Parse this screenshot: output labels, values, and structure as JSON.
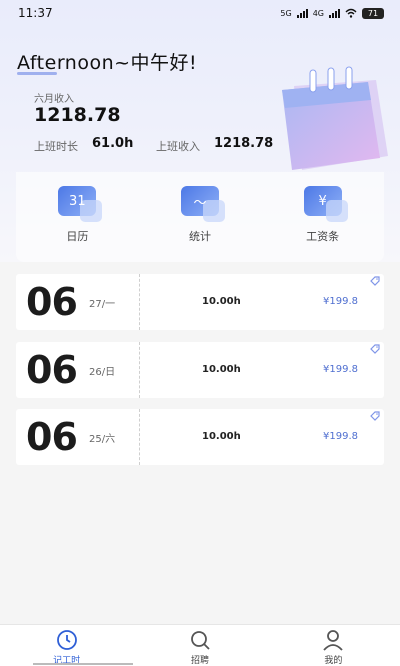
{
  "status_bar": {
    "time": "11:37",
    "network": "5G",
    "network2": "4G",
    "battery": "71"
  },
  "greeting": "Afternoon~中午好!",
  "income": {
    "month_label": "六月收入",
    "month_value": "1218.78",
    "hours_label": "上班时长",
    "hours_value": "61.0h",
    "earnings_label": "上班收入",
    "earnings_value": "1218.78"
  },
  "shortcuts": [
    {
      "label": "日历",
      "icon": "calendar-icon",
      "glyph": "31"
    },
    {
      "label": "统计",
      "icon": "stats-icon",
      "glyph": "〜"
    },
    {
      "label": "工资条",
      "icon": "payslip-icon",
      "glyph": "¥"
    }
  ],
  "records": [
    {
      "month": "06",
      "day": "27/一",
      "hours": "10.00h",
      "pay": "¥199.8"
    },
    {
      "month": "06",
      "day": "26/日",
      "hours": "10.00h",
      "pay": "¥199.8"
    },
    {
      "month": "06",
      "day": "25/六",
      "hours": "10.00h",
      "pay": "¥199.8"
    }
  ],
  "bottom_nav": [
    {
      "label": "记工时",
      "icon": "clock-icon",
      "active": true
    },
    {
      "label": "招聘",
      "icon": "search-icon",
      "active": false
    },
    {
      "label": "我的",
      "icon": "profile-icon",
      "active": false
    }
  ],
  "colors": {
    "accent": "#2f5fd6",
    "pay_text": "#4f6fd0",
    "background": "#f5f5f5"
  }
}
